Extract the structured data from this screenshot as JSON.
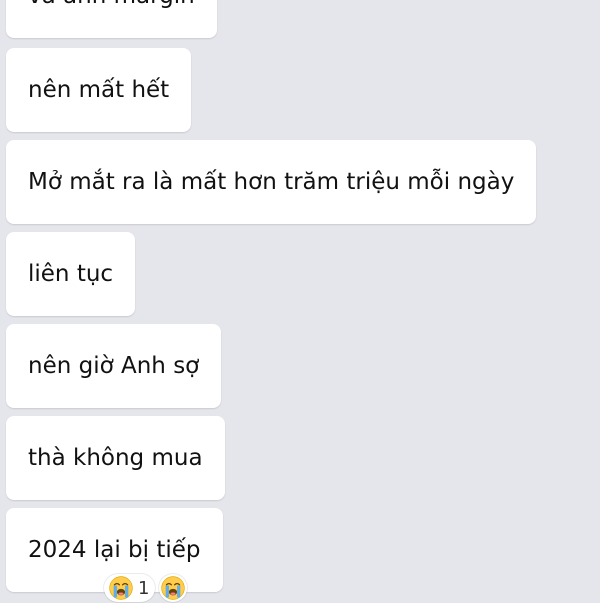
{
  "messages": [
    {
      "text": "và anh margin"
    },
    {
      "text": "nên mất hết"
    },
    {
      "text": "Mở mắt ra là mất hơn trăm triệu mỗi ngày"
    },
    {
      "text": "liên tục"
    },
    {
      "text": "nên giờ Anh sợ"
    },
    {
      "text": "thà không mua"
    },
    {
      "text": "2024 lại bị tiếp"
    }
  ],
  "reactions": {
    "primary": {
      "icon": "loudly-crying-face-icon",
      "count": "1"
    },
    "secondary": {
      "icon": "loudly-crying-face-icon"
    }
  },
  "colors": {
    "background": "#e4e6eb",
    "bubble": "#ffffff",
    "text": "#111111"
  }
}
